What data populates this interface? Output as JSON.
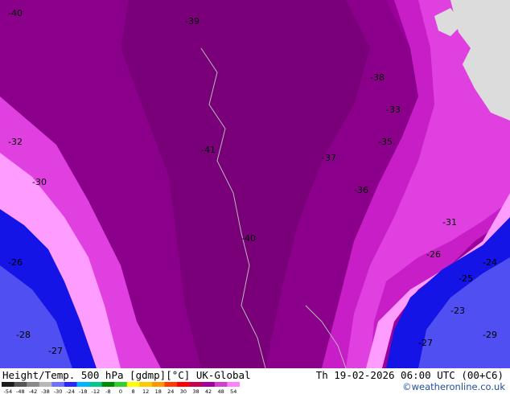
{
  "map": {
    "title": "Height/Temp. 500 hPa [gdmp][°C] UK-Global",
    "valid_time": "Th 19-02-2026 06:00 UTC (00+C6)",
    "credit": "©weatheronline.co.uk",
    "field": "temperature 500 hPa",
    "contour_labels": [
      {
        "value": "-40",
        "region": "northwest-upper"
      },
      {
        "value": "-39",
        "region": "north"
      },
      {
        "value": "-41",
        "region": "centre-trough"
      },
      {
        "value": "-40",
        "region": "centre"
      },
      {
        "value": "-38",
        "region": "north-east"
      },
      {
        "value": "-37",
        "region": "east"
      },
      {
        "value": "-36",
        "region": "east"
      },
      {
        "value": "-35",
        "region": "east"
      },
      {
        "value": "-33",
        "region": "east"
      },
      {
        "value": "-31",
        "region": "east-coast"
      },
      {
        "value": "-29",
        "region": "southeast"
      },
      {
        "value": "-27",
        "region": "southeast"
      },
      {
        "value": "-26",
        "region": "southeast"
      },
      {
        "value": "-25",
        "region": "southeast"
      },
      {
        "value": "-24",
        "region": "southeast"
      },
      {
        "value": "-23",
        "region": "southeast"
      },
      {
        "value": "-32",
        "region": "west"
      },
      {
        "value": "-30",
        "region": "west"
      },
      {
        "value": "-28",
        "region": "southwest"
      },
      {
        "value": "-27",
        "region": "southwest"
      },
      {
        "value": "-26",
        "region": "southwest"
      }
    ],
    "legend": {
      "ticks": [
        "-54",
        "-48",
        "-42",
        "-38",
        "-30",
        "-24",
        "-18",
        "-12",
        "-8",
        "0",
        "8",
        "12",
        "18",
        "24",
        "30",
        "38",
        "42",
        "48",
        "54"
      ],
      "colors": [
        "#1c1c1c",
        "#555555",
        "#8a8a8a",
        "#b8b8b8",
        "#7070ff",
        "#2828ff",
        "#00b4ff",
        "#00c890",
        "#008c00",
        "#30d030",
        "#ffff00",
        "#ffc800",
        "#ff9600",
        "#ff3c00",
        "#ff0000",
        "#c80050",
        "#a000a0",
        "#d040d0",
        "#ff80ff"
      ]
    },
    "colors": {
      "deep_purple": "#7a007a",
      "purple": "#a000a0",
      "magenta": "#d438d4",
      "bright_magenta": "#f050f0",
      "pink": "#ff9cff",
      "blue": "#1414e6",
      "light_blue": "#4f4ff2",
      "land": "#dcdcdc"
    }
  }
}
